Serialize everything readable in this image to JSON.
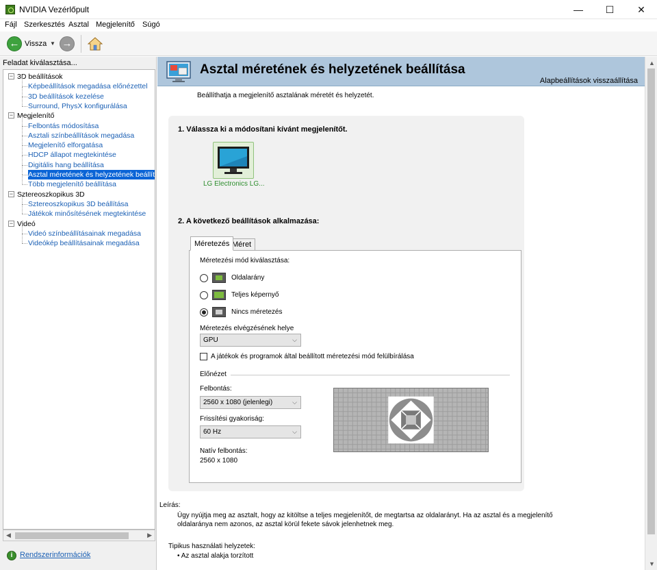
{
  "window": {
    "title": "NVIDIA Vezérlőpult",
    "minimize": "—",
    "maximize": "☐",
    "close": "✕"
  },
  "menu": [
    "Fájl",
    "Szerkesztés",
    "Asztal",
    "Megjelenítő",
    "Súgó"
  ],
  "toolbar": {
    "back_label": "Vissza"
  },
  "sidebar": {
    "heading": "Feladat kiválasztása...",
    "tree": [
      {
        "label": "3D beállítások",
        "type": "cat"
      },
      {
        "label": "Képbeállítások megadása előnézettel",
        "type": "item"
      },
      {
        "label": "3D beállítások kezelése",
        "type": "item"
      },
      {
        "label": "Surround, PhysX konfigurálása",
        "type": "item"
      },
      {
        "label": "Megjelenítő",
        "type": "cat"
      },
      {
        "label": "Felbontás módosítása",
        "type": "item"
      },
      {
        "label": "Asztali színbeállítások megadása",
        "type": "item"
      },
      {
        "label": "Megjelenítő elforgatása",
        "type": "item"
      },
      {
        "label": "HDCP állapot megtekintése",
        "type": "item"
      },
      {
        "label": "Digitális hang beállítása",
        "type": "item"
      },
      {
        "label": "Asztal méretének és helyzetének beállítása",
        "type": "item",
        "selected": true
      },
      {
        "label": "Több megjelenítő beállítása",
        "type": "item"
      },
      {
        "label": "Sztereoszkopikus 3D",
        "type": "cat"
      },
      {
        "label": "Sztereoszkopikus 3D beállítása",
        "type": "item"
      },
      {
        "label": "Játékok minősítésének megtekintése",
        "type": "item"
      },
      {
        "label": "Videó",
        "type": "cat"
      },
      {
        "label": "Videó színbeállításainak megadása",
        "type": "item"
      },
      {
        "label": "Videókép beállításainak megadása",
        "type": "item"
      }
    ],
    "system_info": "Rendszerinformációk"
  },
  "main": {
    "title": "Asztal méretének és helyzetének beállítása",
    "restore_defaults": "Alapbeállítások visszaállítása",
    "intro": "Beállíthatja a megjelenítő asztalának méretét és helyzetét.",
    "step1": "1. Válassza ki a módosítani kívánt megjelenítőt.",
    "display_name": "LG Electronics LG...",
    "step2": "2. A következő beállítások alkalmazása:",
    "tabs": [
      "Méretezés",
      "Méret"
    ],
    "scaling_mode_label": "Méretezési mód kiválasztása:",
    "scaling_modes": [
      {
        "label": "Oldalarány",
        "checked": false
      },
      {
        "label": "Teljes képernyő",
        "checked": false
      },
      {
        "label": "Nincs méretezés",
        "checked": true
      }
    ],
    "perform_on_label": "Méretezés elvégzésének helye",
    "perform_on_value": "GPU",
    "override_label": "A játékok és programok által beállított méretezési mód felülbírálása",
    "override_checked": false,
    "preview_label": "Előnézet",
    "resolution_label": "Felbontás:",
    "resolution_value": "2560 x 1080 (jelenlegi)",
    "refresh_label": "Frissítési gyakoriság:",
    "refresh_value": "60 Hz",
    "native_label": "Natív felbontás:",
    "native_value": "2560 x 1080"
  },
  "description": {
    "heading": "Leírás:",
    "body": "Úgy nyújtja meg az asztalt, hogy az kitöltse a teljes megjelenítőt, de megtartsa az oldalarányt. Ha az asztal és a megjelenítő oldalaránya nem azonos, az asztal körül fekete sávok jelenhetnek meg.",
    "typical_heading": "Tipikus használati helyzetek:",
    "typical_items": [
      "Az asztal alakja torzított"
    ]
  },
  "colors": {
    "header_banner": "#aec6dc",
    "selection": "#0a64d6",
    "link": "#1a5fb4",
    "nvidia_green": "#2c8d2c"
  }
}
